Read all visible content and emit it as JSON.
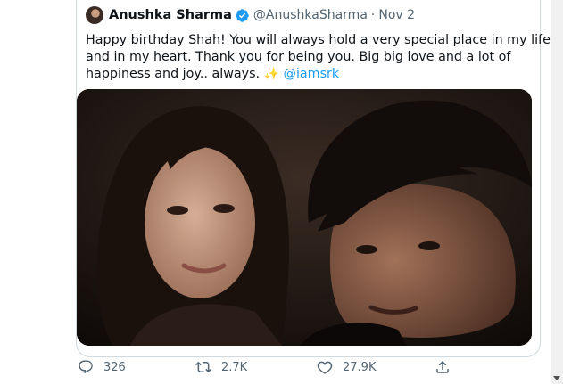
{
  "tweet": {
    "author": "Anushka Sharma",
    "handle": "@AnushkaSharma",
    "separator": "·",
    "date": "Nov 2",
    "text_lines": [
      "Happy birthday Shah! You will always hold a very special place in my life",
      "and in my heart. Thank you for being you. Big big love and a lot of",
      "happiness and joy.. always."
    ],
    "sparkles": "✨",
    "mention": "@iamsrk"
  },
  "actions": {
    "replies": "326",
    "retweets": "2.7K",
    "likes": "27.9K"
  },
  "icons": {
    "verified": "verified-badge-icon",
    "reply": "reply-icon",
    "retweet": "retweet-icon",
    "like": "heart-icon",
    "share": "share-icon"
  },
  "colors": {
    "accent": "#1d9bf0",
    "muted": "#536471",
    "text": "#0f1419"
  }
}
